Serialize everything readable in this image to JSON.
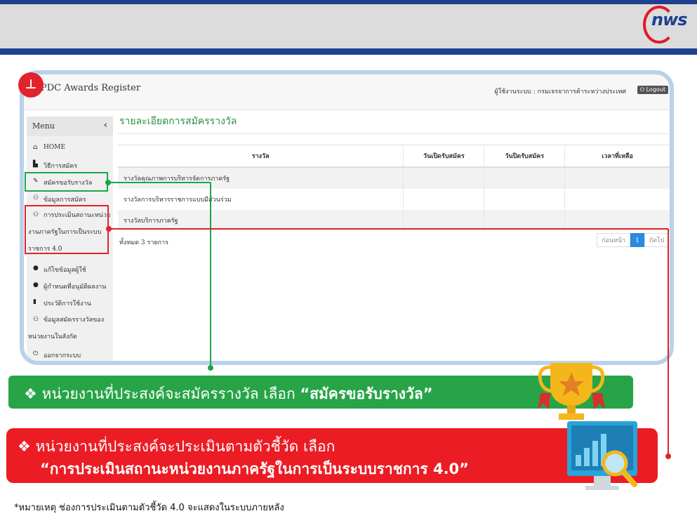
{
  "brand": {
    "logo_text": "nws",
    "accent": "#1f3f8f",
    "logo_red": "#e11a2b"
  },
  "marker": {
    "symbol": "⊥"
  },
  "app": {
    "title": "PDC Awards Register",
    "user_info": "ผู้ใช้งานระบบ : กรมเจรจาการค้าระหว่างประเทศ",
    "logout_label": "Logout"
  },
  "sidebar": {
    "menu_title": "Menu",
    "collapse_icon": "‹",
    "items": [
      {
        "icon": "home-icon",
        "label": "HOME"
      },
      {
        "icon": "file-icon",
        "label": "วิธีการสมัคร"
      },
      {
        "icon": "pencil-icon",
        "label": "สมัครขอรับรางวัล"
      },
      {
        "icon": "users-icon",
        "label": "ข้อมูลการสมัคร"
      },
      {
        "icon": "users-icon",
        "label": "การประเมินสถานะหน่วยงานภาครัฐในการเป็นระบบราชการ 4.0"
      },
      {
        "icon": "user-icon",
        "label": "แก้ไขข้อมูลผู้ใช้"
      },
      {
        "icon": "user-icon",
        "label": "ผู้กำหนดที่อนุมัติผลงาน"
      },
      {
        "icon": "book-icon",
        "label": "ประวัติการใช้งาน"
      },
      {
        "icon": "users-icon",
        "label": "ข้อมูลสมัครรางวัลของหน่วยงานในสังกัด"
      },
      {
        "icon": "power-icon",
        "label": "ออกจากระบบ"
      }
    ]
  },
  "main": {
    "title": "รายละเอียดการสมัครรางวัล",
    "table": {
      "headers": [
        "รางวัล",
        "วันเปิดรับสมัคร",
        "วันปิดรับสมัคร",
        "เวลาที่เหลือ"
      ],
      "rows": [
        [
          "รางวัลคุณภาพการบริหารจัดการภาครัฐ"
        ],
        [
          "รางวัลการบริหารราชการแบบมีส่วนร่วม"
        ],
        [
          "รางวัลบริการภาครัฐ"
        ]
      ]
    },
    "count_text": "ทั้งหมด 3 รายการ",
    "pager": {
      "prev": "ก่อนหน้า",
      "current": "1",
      "next": "ถัดไป"
    }
  },
  "callouts": {
    "green": {
      "bullet": "❖",
      "text": "หน่วยงานที่ประสงค์จะสมัครรางวัล เลือก ",
      "quote": "“สมัครขอรับรางวัล”",
      "color": "#27a447"
    },
    "red": {
      "bullet": "❖",
      "text": "หน่วยงานที่ประสงค์จะประเมินตามตัวชี้วัด เลือก",
      "quote": "“การประเมินสถานะหน่วยงานภาครัฐในการเป็นระบบราชการ 4.0”",
      "color": "#ec1c24"
    }
  },
  "footnote": "*หมายเหตุ ช่องการประเมินตามตัวชี้วัด 4.0 จะแสดงในระบบภายหลัง"
}
